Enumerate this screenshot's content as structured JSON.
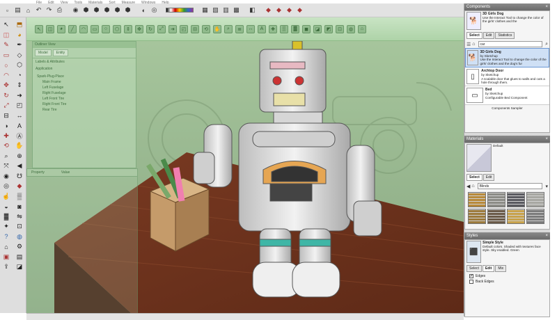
{
  "menu": [
    "File",
    "Edit",
    "View",
    "Tools",
    "Materials",
    "Sort",
    "Measure",
    "Windows",
    "Help"
  ],
  "outliner": {
    "title": "Outliner View",
    "tabs": [
      "Model",
      "Entity"
    ],
    "section": "Labels & Attributes",
    "category": "Application",
    "tree": [
      "Spark-Plug-Place",
      "Main Frame",
      "Left Fuselage",
      "Right Fuselage",
      "Left Front Tire",
      "Right Front Tire",
      "Rear Tire"
    ]
  },
  "properties": {
    "label": "Property",
    "value": "Value"
  },
  "components": {
    "title": "Components",
    "preview_name": "3D Girls Dog",
    "preview_desc": "Use the Interact Tool to change the color of the girls' clothes and the",
    "tabs": [
      "Select",
      "Edit",
      "Statistics"
    ],
    "search_value": "car",
    "items": [
      {
        "name": "3D Girls Dog",
        "by": "by Sketchup",
        "desc": "Use the Interact Tool to change the color of the girls' clothes and the dog's fur"
      },
      {
        "name": "Archtop Door",
        "by": "by Sketchup",
        "desc": "A scalable door that glues to walls and cuts a hole through them."
      },
      {
        "name": "Bed",
        "by": "by Sketchup",
        "desc": "Configurable Bed Component"
      }
    ],
    "footer": "Components Sampler"
  },
  "materials": {
    "title": "Materials",
    "current": "Default",
    "tabs": [
      "Select",
      "Edit"
    ],
    "dropdown_value": "Blinds",
    "swatches": [
      "#b88a3a",
      "#8c8c86",
      "#5a5a60",
      "#a7a7a2",
      "#9c7a3c",
      "#6a5a48",
      "#c8a24a",
      "#7b7b7b"
    ]
  },
  "styles": {
    "title": "Styles",
    "name": "Simple Style",
    "desc": "Default colors. Shaded with textures face style. Sky enabled. Green",
    "tabs": [
      "Select",
      "Edit",
      "Mix"
    ],
    "options": [
      {
        "label": "Edges",
        "checked": true
      },
      {
        "label": "Back Edges",
        "checked": false
      }
    ]
  },
  "colors": {
    "viewport_bg": "#97b48e",
    "toolbar_green": "#aed3a8",
    "tray_title": "#777777"
  }
}
